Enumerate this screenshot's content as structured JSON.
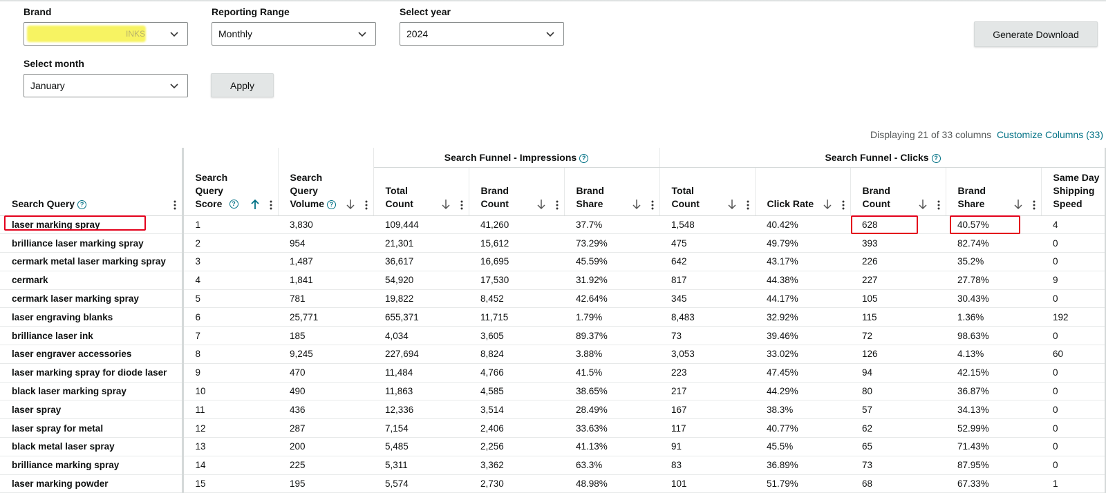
{
  "filters": {
    "brand": {
      "label": "Brand",
      "value": "INKS"
    },
    "reporting_range": {
      "label": "Reporting Range",
      "value": "Monthly"
    },
    "select_year": {
      "label": "Select year",
      "value": "2024"
    },
    "select_month": {
      "label": "Select month",
      "value": "January"
    },
    "apply_label": "Apply",
    "generate_label": "Generate Download"
  },
  "columns_info": {
    "text": "Displaying 21 of 33 columns",
    "link": "Customize Columns (33)"
  },
  "groups": {
    "impressions": "Search Funnel - Impressions",
    "clicks": "Search Funnel - Clicks"
  },
  "headers": {
    "query": "Search Query",
    "score": [
      "Search",
      "Query",
      "Score"
    ],
    "volume": [
      "Search",
      "Query",
      "Volume"
    ],
    "imp_total": [
      "Total",
      "Count"
    ],
    "imp_brand_count": [
      "Brand",
      "Count"
    ],
    "imp_brand_share": [
      "Brand",
      "Share"
    ],
    "clk_total": [
      "Total",
      "Count"
    ],
    "clk_rate": [
      "Click Rate"
    ],
    "clk_brand_count": [
      "Brand",
      "Count"
    ],
    "clk_brand_share": [
      "Brand",
      "Share"
    ],
    "same_day": [
      "Same Day",
      "Shipping",
      "Speed"
    ]
  },
  "rows": [
    [
      "laser marking spray",
      "1",
      "3,830",
      "109,444",
      "41,260",
      "37.7%",
      "1,548",
      "40.42%",
      "628",
      "40.57%",
      "4"
    ],
    [
      "brilliance laser marking spray",
      "2",
      "954",
      "21,301",
      "15,612",
      "73.29%",
      "475",
      "49.79%",
      "393",
      "82.74%",
      "0"
    ],
    [
      "cermark metal laser marking spray",
      "3",
      "1,487",
      "36,617",
      "16,695",
      "45.59%",
      "642",
      "43.17%",
      "226",
      "35.2%",
      "0"
    ],
    [
      "cermark",
      "4",
      "1,841",
      "54,920",
      "17,530",
      "31.92%",
      "817",
      "44.38%",
      "227",
      "27.78%",
      "9"
    ],
    [
      "cermark laser marking spray",
      "5",
      "781",
      "19,822",
      "8,452",
      "42.64%",
      "345",
      "44.17%",
      "105",
      "30.43%",
      "0"
    ],
    [
      "laser engraving blanks",
      "6",
      "25,771",
      "655,371",
      "11,715",
      "1.79%",
      "8,483",
      "32.92%",
      "115",
      "1.36%",
      "192"
    ],
    [
      "brilliance laser ink",
      "7",
      "185",
      "4,034",
      "3,605",
      "89.37%",
      "73",
      "39.46%",
      "72",
      "98.63%",
      "0"
    ],
    [
      "laser engraver accessories",
      "8",
      "9,245",
      "227,694",
      "8,824",
      "3.88%",
      "3,053",
      "33.02%",
      "126",
      "4.13%",
      "60"
    ],
    [
      "laser marking spray for diode laser",
      "9",
      "470",
      "11,484",
      "4,766",
      "41.5%",
      "223",
      "47.45%",
      "94",
      "42.15%",
      "0"
    ],
    [
      "black laser marking spray",
      "10",
      "490",
      "11,863",
      "4,585",
      "38.65%",
      "217",
      "44.29%",
      "80",
      "36.87%",
      "0"
    ],
    [
      "laser spray",
      "11",
      "436",
      "12,336",
      "3,514",
      "28.49%",
      "167",
      "38.3%",
      "57",
      "34.13%",
      "0"
    ],
    [
      "laser spray for metal",
      "12",
      "287",
      "7,154",
      "2,406",
      "33.63%",
      "117",
      "40.77%",
      "62",
      "52.99%",
      "0"
    ],
    [
      "black metal laser spray",
      "13",
      "200",
      "5,485",
      "2,256",
      "41.13%",
      "91",
      "45.5%",
      "65",
      "71.43%",
      "0"
    ],
    [
      "brilliance marking spray",
      "14",
      "225",
      "5,311",
      "3,362",
      "63.3%",
      "83",
      "36.89%",
      "73",
      "87.95%",
      "0"
    ],
    [
      "laser marking powder",
      "15",
      "195",
      "5,574",
      "2,730",
      "48.98%",
      "101",
      "51.79%",
      "68",
      "67.33%",
      "1"
    ]
  ]
}
